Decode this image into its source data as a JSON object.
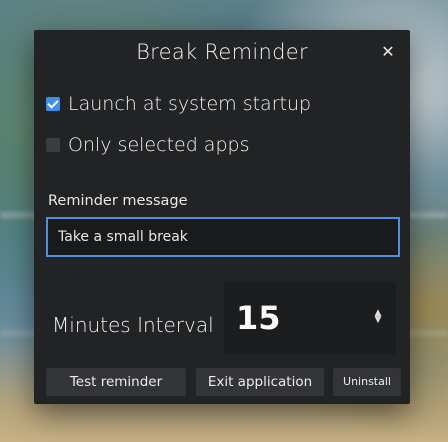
{
  "window": {
    "title": "Break Reminder",
    "close_glyph": "✕"
  },
  "options": {
    "launch_at_startup": {
      "label": "Launch at system startup",
      "checked": true
    },
    "only_selected_apps": {
      "label": "Only selected apps",
      "checked": false
    }
  },
  "reminder": {
    "label": "Reminder message",
    "value": "Take a small break"
  },
  "interval": {
    "label": "Minutes Interval",
    "value": "15",
    "spinner_icon": "up-down-arrows"
  },
  "buttons": {
    "test": "Test reminder",
    "exit": "Exit application",
    "uninstall": "Uninstall"
  },
  "colors": {
    "dialog_bg": "#222325",
    "accent": "#3f8fe8",
    "input_border": "#4f8fdf"
  }
}
